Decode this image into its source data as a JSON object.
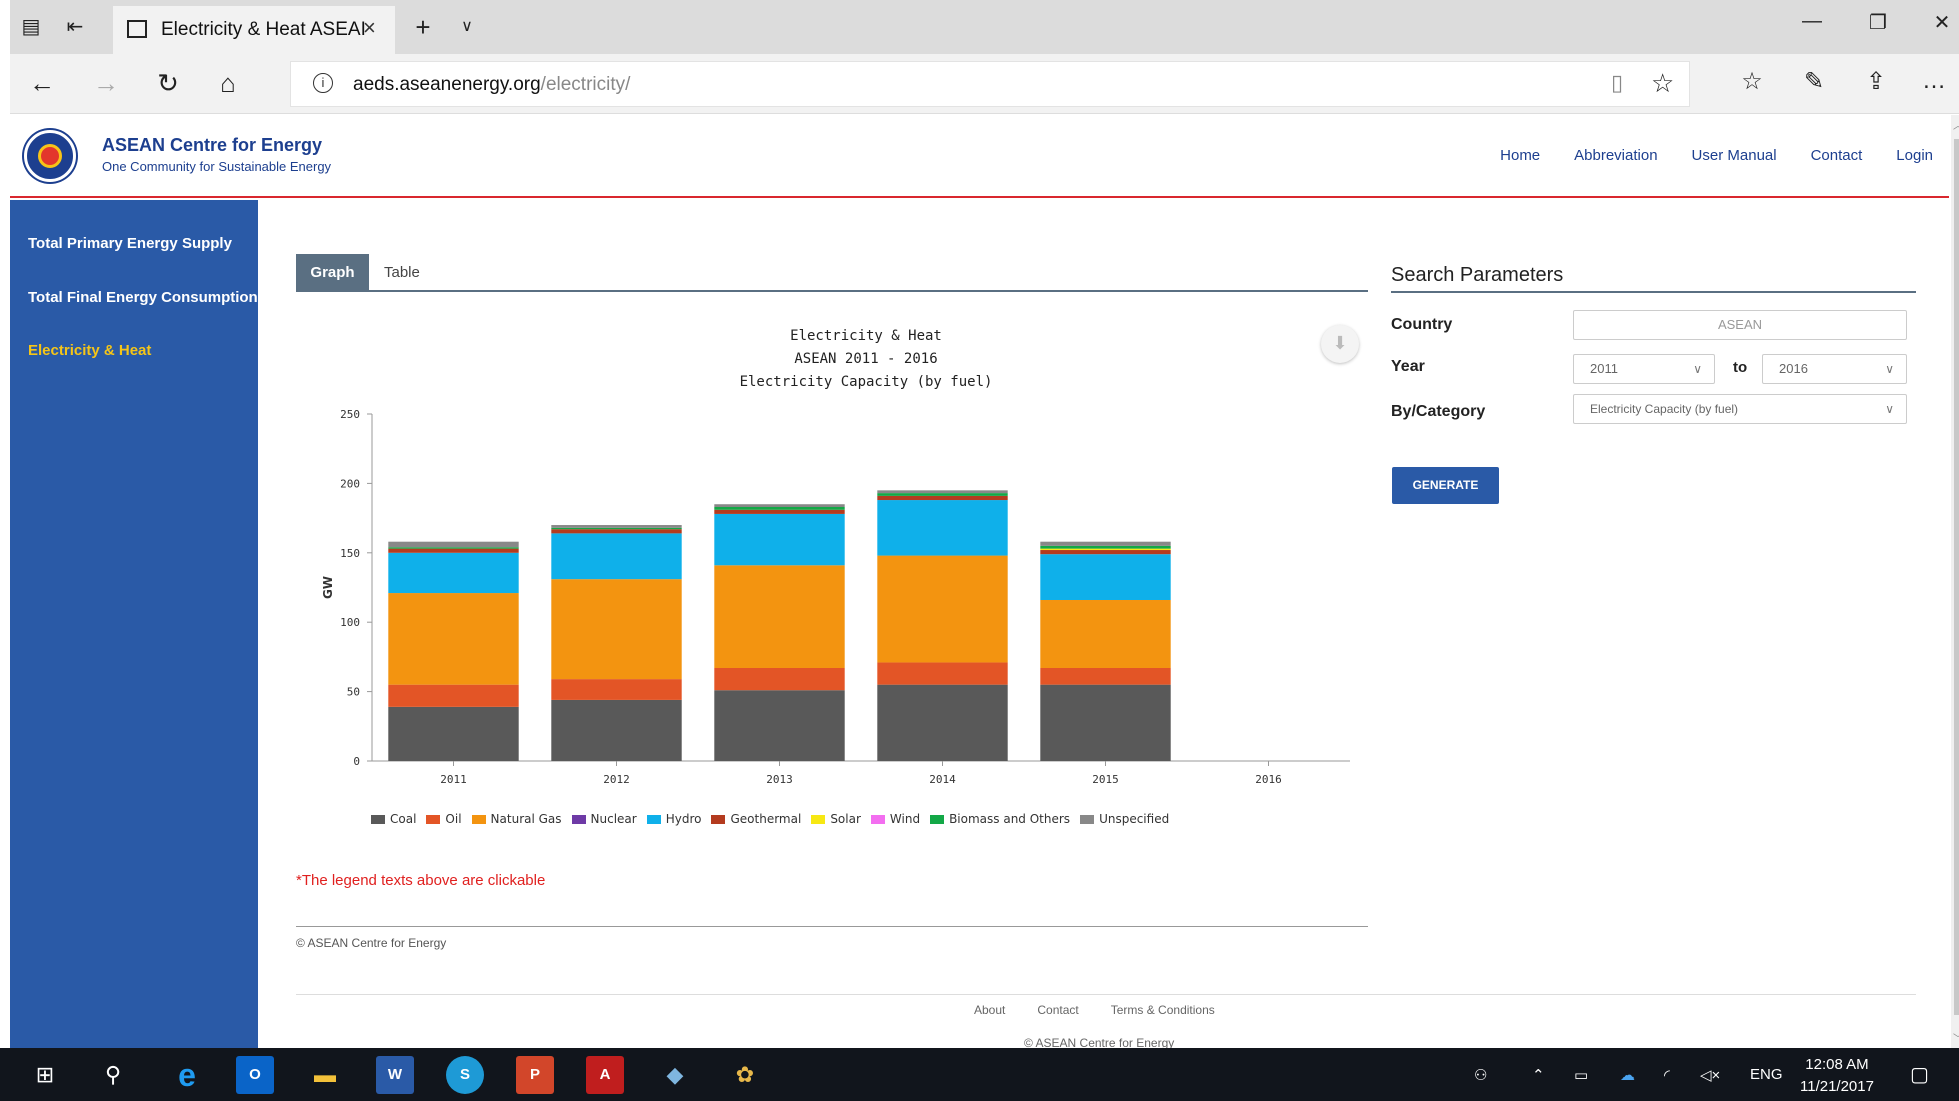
{
  "browser": {
    "tab_title": "Electricity & Heat ASEAI",
    "url_host": "aeds.aseanenergy.org",
    "url_path": "/electricity/"
  },
  "site": {
    "brand_name": "ASEAN Centre for Energy",
    "brand_tagline": "One Community for Sustainable Energy",
    "nav": [
      "Home",
      "Abbreviation",
      "User Manual",
      "Contact",
      "Login"
    ]
  },
  "sidebar": {
    "items": [
      {
        "label": "Total Primary Energy Supply",
        "active": false
      },
      {
        "label": "Total Final Energy Consumption",
        "active": false
      },
      {
        "label": "Electricity & Heat",
        "active": true
      }
    ]
  },
  "view_tabs": {
    "graph": "Graph",
    "table": "Table"
  },
  "chart_data": {
    "type": "bar",
    "stacked": true,
    "title": "Electricity & Heat",
    "subtitle_1": "ASEAN 2011 - 2016",
    "subtitle_2": "Electricity Capacity (by fuel)",
    "ylabel": "GW",
    "xlabel": "",
    "ylim": [
      0,
      250
    ],
    "yticks": [
      0,
      50,
      100,
      150,
      200,
      250
    ],
    "categories": [
      "2011",
      "2012",
      "2013",
      "2014",
      "2015",
      "2016"
    ],
    "series": [
      {
        "name": "Coal",
        "color": "#595959",
        "values": [
          39,
          44,
          51,
          55,
          55,
          0
        ]
      },
      {
        "name": "Oil",
        "color": "#e35526",
        "values": [
          16,
          15,
          16,
          16,
          12,
          0
        ]
      },
      {
        "name": "Natural Gas",
        "color": "#f39410",
        "values": [
          66,
          72,
          74,
          77,
          49,
          0
        ]
      },
      {
        "name": "Nuclear",
        "color": "#6e3aa6",
        "values": [
          0,
          0,
          0,
          0,
          0,
          0
        ]
      },
      {
        "name": "Hydro",
        "color": "#0fb0ea",
        "values": [
          29,
          33,
          37,
          40,
          33,
          0
        ]
      },
      {
        "name": "Geothermal",
        "color": "#b43b1f",
        "values": [
          3,
          3,
          3,
          3,
          3,
          0
        ]
      },
      {
        "name": "Solar",
        "color": "#f7e813",
        "values": [
          0,
          0,
          0,
          0,
          1,
          0
        ]
      },
      {
        "name": "Wind",
        "color": "#f36ef0",
        "values": [
          0,
          0,
          0,
          0,
          0,
          0
        ]
      },
      {
        "name": "Biomass and Others",
        "color": "#13a847",
        "values": [
          1,
          1,
          2,
          2,
          2,
          0
        ]
      },
      {
        "name": "Unspecified",
        "color": "#888888",
        "values": [
          4,
          2,
          2,
          2,
          3,
          0
        ]
      }
    ],
    "legend_position": "bottom",
    "grid": false
  },
  "chart_note": "*The legend texts above are clickable",
  "content_copyright": "© ASEAN Centre for Energy",
  "search": {
    "title": "Search Parameters",
    "country_label": "Country",
    "country_placeholder": "ASEAN",
    "year_label": "Year",
    "year_from": "2011",
    "year_to_label": "to",
    "year_to": "2016",
    "category_label": "By/Category",
    "category_value": "Electricity Capacity (by fuel)",
    "generate_label": "GENERATE"
  },
  "footer": {
    "links": [
      "About",
      "Contact",
      "Terms & Conditions"
    ],
    "copyright": "© ASEAN Centre for Energy"
  },
  "taskbar": {
    "language": "ENG",
    "time": "12:08 AM",
    "date": "11/21/2017"
  },
  "colors": {
    "sidebar": "#2a5aa7",
    "accent_red": "#d9272e",
    "active_yellow": "#f5c518"
  }
}
